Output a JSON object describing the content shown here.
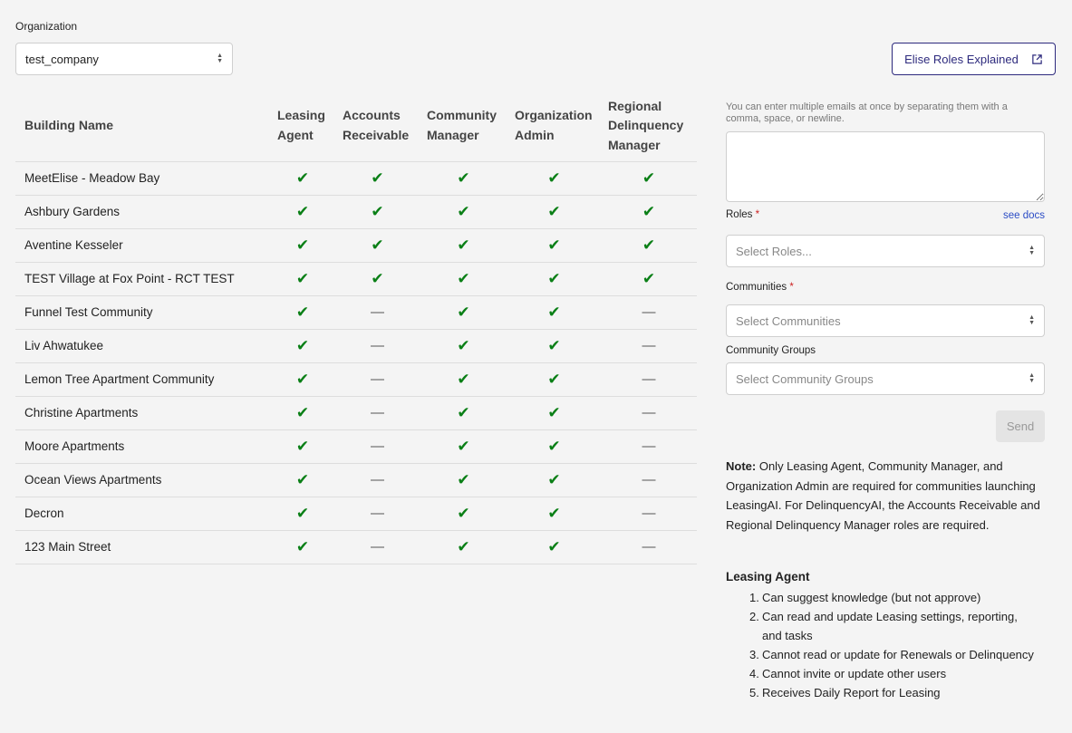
{
  "organization": {
    "label": "Organization",
    "value": "test_company"
  },
  "roles_button": {
    "label": "Elise Roles Explained",
    "icon": "external-link-icon"
  },
  "table": {
    "columns": [
      "Building Name",
      "Leasing Agent",
      "Accounts Receivable",
      "Community Manager",
      "Organization Admin",
      "Regional Delinquency Manager"
    ],
    "rows": [
      {
        "name": "MeetElise - Meadow Bay",
        "roles": [
          true,
          true,
          true,
          true,
          true
        ]
      },
      {
        "name": "Ashbury Gardens",
        "roles": [
          true,
          true,
          true,
          true,
          true
        ]
      },
      {
        "name": "Aventine Kesseler",
        "roles": [
          true,
          true,
          true,
          true,
          true
        ]
      },
      {
        "name": "TEST Village at Fox Point - RCT TEST",
        "roles": [
          true,
          true,
          true,
          true,
          true
        ]
      },
      {
        "name": "Funnel Test Community",
        "roles": [
          true,
          false,
          true,
          true,
          false
        ]
      },
      {
        "name": "Liv Ahwatukee",
        "roles": [
          true,
          false,
          true,
          true,
          false
        ]
      },
      {
        "name": "Lemon Tree Apartment Community",
        "roles": [
          true,
          false,
          true,
          true,
          false
        ]
      },
      {
        "name": "Christine Apartments",
        "roles": [
          true,
          false,
          true,
          true,
          false
        ]
      },
      {
        "name": "Moore Apartments",
        "roles": [
          true,
          false,
          true,
          true,
          false
        ]
      },
      {
        "name": "Ocean Views Apartments",
        "roles": [
          true,
          false,
          true,
          true,
          false
        ]
      },
      {
        "name": "Decron",
        "roles": [
          true,
          false,
          true,
          true,
          false
        ]
      },
      {
        "name": "123 Main Street",
        "roles": [
          true,
          false,
          true,
          true,
          false
        ]
      }
    ],
    "check_glyph": "✔",
    "dash_glyph": "—"
  },
  "invite": {
    "email_hint": "You can enter multiple emails at once by separating them with a comma, space, or newline.",
    "roles_label": "Roles",
    "required_mark": "*",
    "see_docs": "see docs",
    "roles_placeholder": "Select Roles...",
    "communities_label": "Communities",
    "communities_placeholder": "Select Communities",
    "groups_label": "Community Groups",
    "groups_placeholder": "Select Community Groups",
    "send_label": "Send"
  },
  "note": {
    "prefix": "Note:",
    "text": "Only Leasing Agent, Community Manager, and Organization Admin are required for communities launching LeasingAI. For DelinquencyAI, the Accounts Receivable and Regional Delinquency Manager roles are required."
  },
  "leasing_agent": {
    "title": "Leasing Agent",
    "items": [
      "Can suggest knowledge (but not approve)",
      "Can read and update Leasing settings, reporting, and tasks",
      "Cannot read or update for Renewals or Delinquency",
      "Cannot invite or update other users",
      "Receives Daily Report for Leasing"
    ]
  },
  "colors": {
    "accent": "#2d2a7d",
    "check": "#0a7f16",
    "link": "#2b4cc5"
  }
}
